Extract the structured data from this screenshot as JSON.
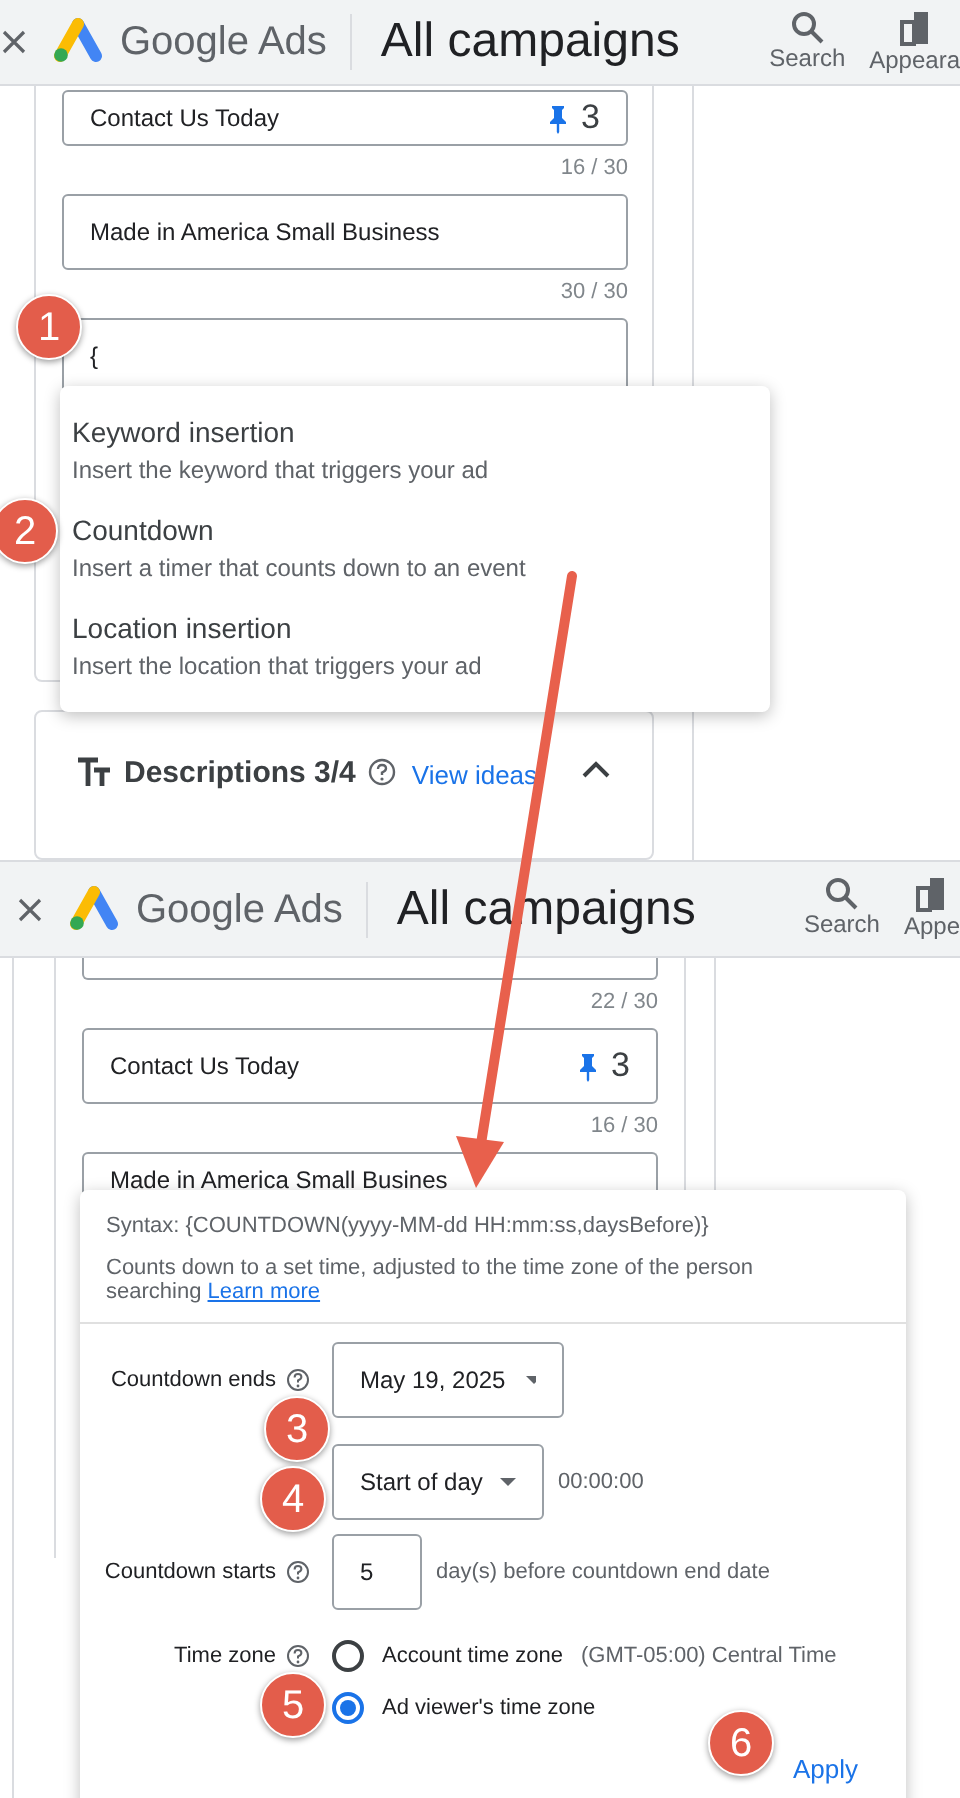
{
  "top_screen": {
    "header": {
      "product": "Google Ads",
      "title": "All campaigns",
      "actions": [
        {
          "label": "Search",
          "kind": "search"
        },
        {
          "label": "Appeara",
          "kind": "appearance"
        }
      ]
    },
    "headlines": [
      {
        "value": "Contact Us Today",
        "pin": "3",
        "counter": "16 / 30"
      },
      {
        "value": "Made in America Small Business",
        "counter": "30 / 30"
      },
      {
        "value": "{",
        "focused": true
      }
    ],
    "insert_menu": [
      {
        "title": "Keyword insertion",
        "description": "Insert the keyword that triggers your ad"
      },
      {
        "title": "Countdown",
        "description": "Insert a timer that counts down to an event"
      },
      {
        "title": "Location insertion",
        "description": "Insert the location that triggers your ad"
      }
    ],
    "descriptions_section": {
      "title": "Descriptions 3/4",
      "link": "View ideas",
      "expanded": true
    }
  },
  "bottom_screen": {
    "header": {
      "product": "Google Ads",
      "title": "All campaigns",
      "actions": [
        {
          "label": "Search",
          "kind": "search"
        },
        {
          "label": "Appe",
          "kind": "appearance"
        }
      ]
    },
    "headlines": [
      {
        "counter": "22 / 30",
        "kind": "clipped"
      },
      {
        "value": "Contact Us Today",
        "pin": "3",
        "counter": "16 / 30"
      },
      {
        "value": "Made in America Small Busines",
        "kind": "covered"
      }
    ],
    "countdown_popup": {
      "syntax": "Syntax: {COUNTDOWN(yyyy-MM-dd HH:mm:ss,daysBefore)}",
      "description": "Counts down to a set time, adjusted to the time zone of the person searching",
      "learn_more": "Learn more",
      "ends_label": "Countdown ends",
      "end_date": "May 19, 2025",
      "time_option": "Start of day",
      "time_value": "00:00:00",
      "starts_label": "Countdown starts",
      "days_before": "5",
      "days_suffix": "day(s) before countdown end date",
      "time_zone_label": "Time zone",
      "time_zones": [
        {
          "label": "Account time zone",
          "note": "(GMT-05:00) Central Time",
          "selected": false
        },
        {
          "label": "Ad viewer's time zone",
          "selected": true
        }
      ],
      "apply": "Apply"
    }
  },
  "step_badges": [
    "1",
    "2",
    "3",
    "4",
    "5",
    "6"
  ]
}
